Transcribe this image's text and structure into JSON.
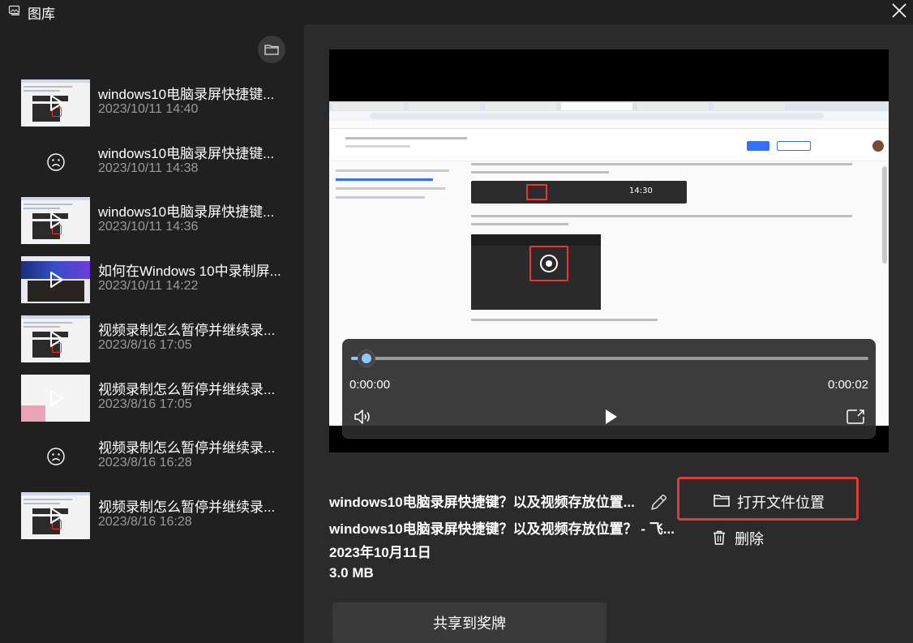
{
  "window": {
    "title": "图库"
  },
  "sidebar": {
    "items": [
      {
        "title": "windows10电脑录屏快捷键...",
        "date": "2023/10/11 14:40",
        "thumb": "shot"
      },
      {
        "title": "windows10电脑录屏快捷键...",
        "date": "2023/10/11 14:38",
        "thumb": "empty"
      },
      {
        "title": "windows10电脑录屏快捷键...",
        "date": "2023/10/11 14:36",
        "thumb": "shot"
      },
      {
        "title": "如何在Windows 10中录制屏...",
        "date": "2023/10/11 14:22",
        "thumb": "poster"
      },
      {
        "title": "视频录制怎么暂停并继续录...",
        "date": "2023/8/16 17:05",
        "thumb": "shot"
      },
      {
        "title": "视频录制怎么暂停并继续录...",
        "date": "2023/8/16 17:05",
        "thumb": "pinky"
      },
      {
        "title": "视频录制怎么暂停并继续录...",
        "date": "2023/8/16 16:28",
        "thumb": "empty"
      },
      {
        "title": "视频录制怎么暂停并继续录...",
        "date": "2023/8/16 16:28",
        "thumb": "shot"
      }
    ]
  },
  "player": {
    "current_time": "0:00:00",
    "duration": "0:00:02",
    "progress_fraction": 0.03,
    "screen_clock": "14:30"
  },
  "details": {
    "name": "windows10电脑录屏快捷键？以及视频存放位置...",
    "title": "windows10电脑录屏快捷键？以及视频存放位置？ - 飞...",
    "date": "2023年10月11日",
    "size": "3.0 MB"
  },
  "actions": {
    "open_location": "打开文件位置",
    "delete": "删除",
    "share": "共享到奖牌"
  },
  "colors": {
    "accent": "#8fc6ff",
    "highlight_border": "#e03a3a"
  }
}
